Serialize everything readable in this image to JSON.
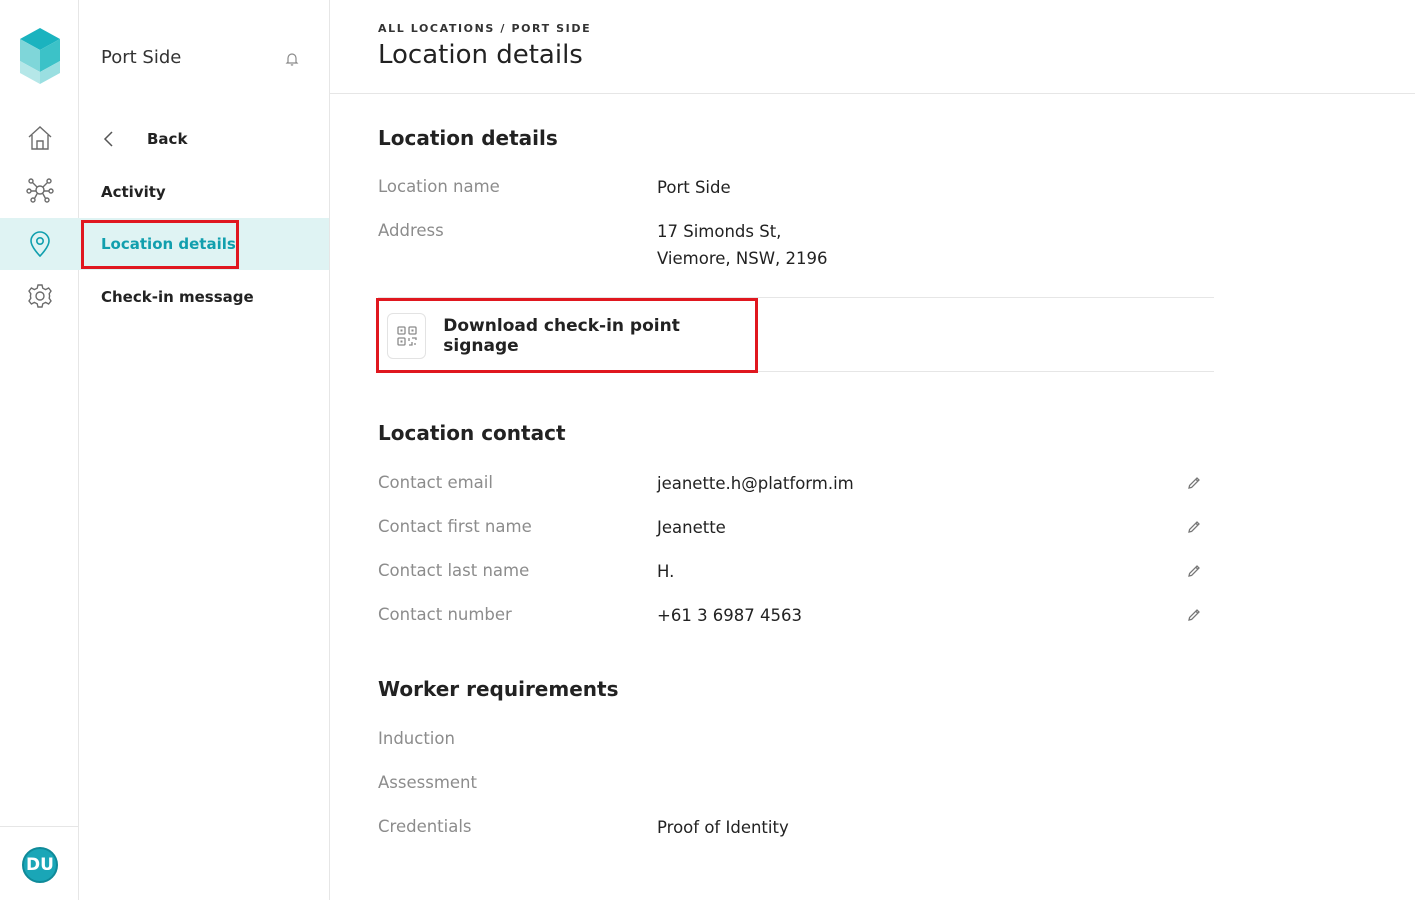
{
  "rail": {
    "items": [
      {
        "name": "home",
        "icon": "home-icon"
      },
      {
        "name": "network",
        "icon": "network-icon"
      },
      {
        "name": "locations",
        "icon": "location-pin-icon",
        "active": true
      },
      {
        "name": "settings",
        "icon": "gear-icon"
      }
    ],
    "avatar": "DU"
  },
  "subnav": {
    "title": "Port Side",
    "back_label": "Back",
    "items": [
      {
        "label": "Activity"
      },
      {
        "label": "Location details",
        "active": true
      },
      {
        "label": "Check-in message"
      }
    ]
  },
  "header": {
    "breadcrumb_all": "ALL LOCATIONS",
    "breadcrumb_sep": "/",
    "breadcrumb_current": "PORT SIDE",
    "title": "Location details"
  },
  "details": {
    "section_title": "Location details",
    "name_label": "Location name",
    "name_value": "Port Side",
    "address_label": "Address",
    "address_line1": "17 Simonds St,",
    "address_line2": "Viemore, NSW, 2196"
  },
  "signage": {
    "label": "Download check-in point signage"
  },
  "contact": {
    "section_title": "Location contact",
    "rows": [
      {
        "label": "Contact email",
        "value": "jeanette.h@platform.im"
      },
      {
        "label": "Contact first name",
        "value": "Jeanette"
      },
      {
        "label": "Contact last name",
        "value": "H."
      },
      {
        "label": "Contact number",
        "value": "+61 3 6987 4563"
      }
    ]
  },
  "requirements": {
    "section_title": "Worker requirements",
    "rows": [
      {
        "label": "Induction",
        "value": ""
      },
      {
        "label": "Assessment",
        "value": ""
      },
      {
        "label": "Credentials",
        "value": "Proof of Identity"
      }
    ]
  },
  "colors": {
    "accent": "#119fae",
    "active_bg": "#dff3f3",
    "highlight": "#e0171f"
  }
}
